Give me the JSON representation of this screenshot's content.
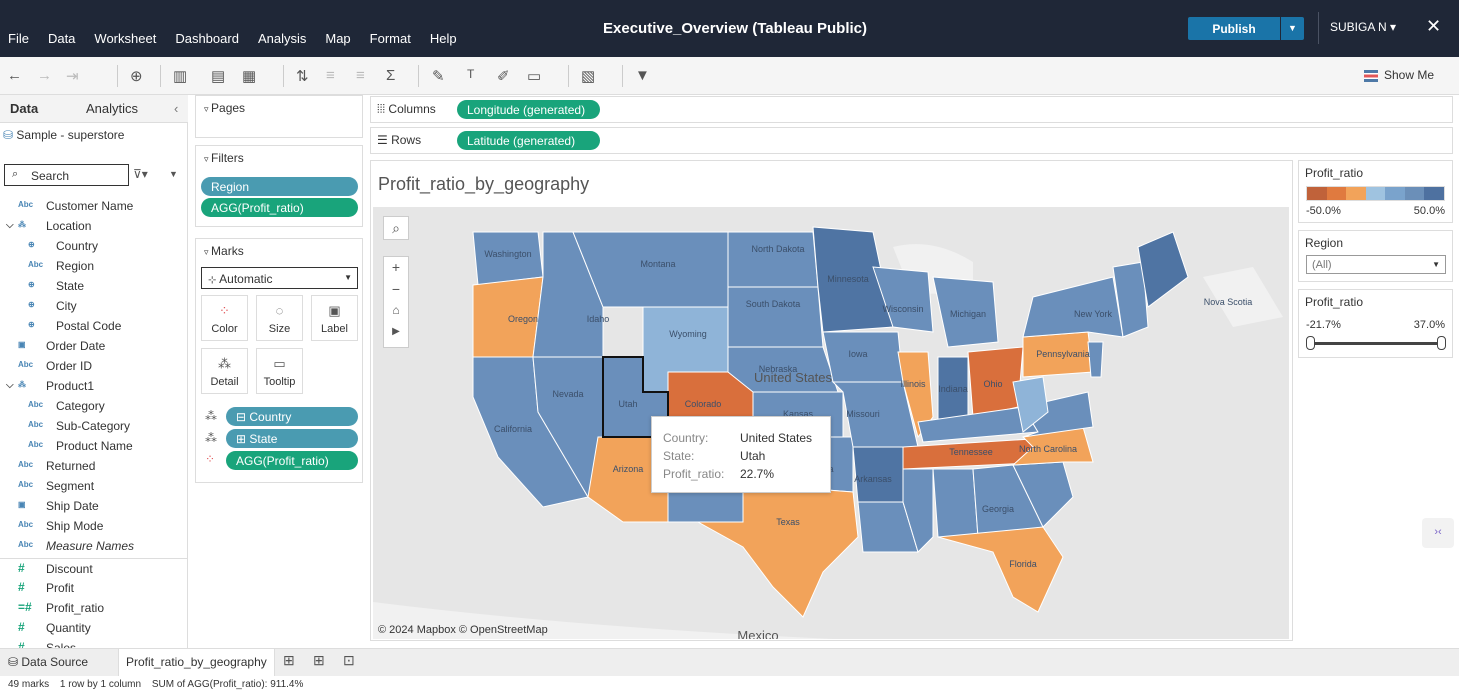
{
  "window": {
    "title": "Executive_Overview (Tableau Public)",
    "menu": [
      "File",
      "Data",
      "Worksheet",
      "Dashboard",
      "Analysis",
      "Map",
      "Format",
      "Help"
    ],
    "publish": "Publish",
    "user": "SUBIGA N ▾",
    "close": "✕"
  },
  "toolbar": {
    "show_me": "Show Me"
  },
  "left": {
    "tabs": [
      "Data",
      "Analytics"
    ],
    "source": "Sample - superstore",
    "search_placeholder": "Search",
    "fields": [
      {
        "icon": "Abc",
        "name": "Customer Name",
        "indent": 0
      },
      {
        "icon": "hier",
        "name": "Location",
        "indent": 0,
        "group": true
      },
      {
        "icon": "globe",
        "name": "Country",
        "indent": 1
      },
      {
        "icon": "Abc",
        "name": "Region",
        "indent": 1
      },
      {
        "icon": "globe",
        "name": "State",
        "indent": 1
      },
      {
        "icon": "globe",
        "name": "City",
        "indent": 1
      },
      {
        "icon": "globe",
        "name": "Postal Code",
        "indent": 1
      },
      {
        "icon": "cal",
        "name": "Order Date",
        "indent": 0
      },
      {
        "icon": "Abc",
        "name": "Order ID",
        "indent": 0
      },
      {
        "icon": "hier",
        "name": "Product1",
        "indent": 0,
        "group": true
      },
      {
        "icon": "Abc",
        "name": "Category",
        "indent": 1
      },
      {
        "icon": "Abc",
        "name": "Sub-Category",
        "indent": 1
      },
      {
        "icon": "Abc",
        "name": "Product Name",
        "indent": 1
      },
      {
        "icon": "Abc",
        "name": "Returned",
        "indent": 0
      },
      {
        "icon": "Abc",
        "name": "Segment",
        "indent": 0
      },
      {
        "icon": "cal",
        "name": "Ship Date",
        "indent": 0
      },
      {
        "icon": "Abc",
        "name": "Ship Mode",
        "indent": 0
      },
      {
        "icon": "Abc",
        "name": "Measure Names",
        "indent": 0,
        "italic": true
      },
      {
        "icon": "#",
        "name": "Discount",
        "indent": 0,
        "measure": true
      },
      {
        "icon": "#",
        "name": "Profit",
        "indent": 0,
        "measure": true
      },
      {
        "icon": "=#",
        "name": "Profit_ratio",
        "indent": 0,
        "measure": true
      },
      {
        "icon": "#",
        "name": "Quantity",
        "indent": 0,
        "measure": true
      },
      {
        "icon": "#",
        "name": "Sales",
        "indent": 0,
        "measure": true
      }
    ]
  },
  "cards": {
    "pages": "Pages",
    "filters": "Filters",
    "filter_pills": [
      "Region",
      "AGG(Profit_ratio)"
    ],
    "marks": "Marks",
    "mark_type": "Automatic",
    "mark_buttons": [
      "Color",
      "Size",
      "Label",
      "Detail",
      "Tooltip"
    ],
    "mark_pills": [
      "Country",
      "State",
      "AGG(Profit_ratio)"
    ]
  },
  "shelves": {
    "columns_label": "Columns",
    "columns_pill": "Longitude (generated)",
    "rows_label": "Rows",
    "rows_pill": "Latitude (generated)"
  },
  "viz": {
    "title": "Profit_ratio_by_geography",
    "credit": "© 2024 Mapbox  © OpenStreetMap",
    "map_labels": [
      "Washington",
      "Montana",
      "North Dakota",
      "Minnesota",
      "Oregon",
      "Idaho",
      "South Dakota",
      "Wisconsin",
      "Wyoming",
      "Michigan",
      "New York",
      "Nevada",
      "Utah",
      "Nebraska",
      "Iowa",
      "United States",
      "Colorado",
      "Kansas",
      "Missouri",
      "Illinois",
      "Indiana",
      "Ohio",
      "Pennsylvania",
      "California",
      "Arizona",
      "New Mexico",
      "Oklahoma",
      "Arkansas",
      "Tennessee",
      "North Carolina",
      "Texas",
      "Georgia",
      "Florida",
      "Nova Scotia",
      "Mexico"
    ]
  },
  "tooltip": {
    "country_key": "Country:",
    "country_val": "United States",
    "state_key": "State:",
    "state_val": "Utah",
    "ratio_key": "Profit_ratio:",
    "ratio_val": "22.7%"
  },
  "legend": {
    "title": "Profit_ratio",
    "min": "-50.0%",
    "max": "50.0%",
    "colors": [
      "#c0623a",
      "#e07a3f",
      "#f2a35a",
      "#9fc3e0",
      "#7aa3cc",
      "#6b8fb8",
      "#4e71a0"
    ]
  },
  "region_filter": {
    "title": "Region",
    "value": "(All)"
  },
  "ratio_filter": {
    "title": "Profit_ratio",
    "min": "-21.7%",
    "max": "37.0%"
  },
  "bottom": {
    "tabs": [
      "Data Source",
      "Profit_ratio_by_geography"
    ]
  },
  "status": {
    "marks": "49 marks",
    "rows": "1 row by 1 column",
    "sum": "SUM of AGG(Profit_ratio): 911.4%"
  },
  "colors": {
    "blue": "#6a8fbb",
    "dark": "#4f74a3",
    "light": "#8fb4d8",
    "orange": "#f2a35a",
    "dorange": "#d96f3c",
    "teal": "#19a47b"
  }
}
